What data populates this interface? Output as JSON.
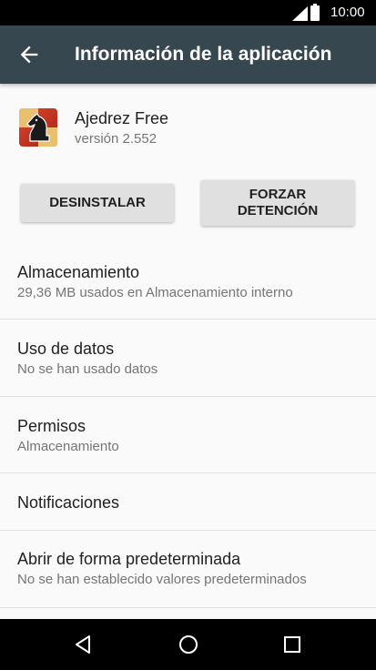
{
  "status_bar": {
    "time": "10:00",
    "signal_icon": "signal-icon",
    "battery_icon": "battery-icon"
  },
  "app_bar": {
    "title": "Información de la aplicación",
    "back_icon": "arrow-back-icon"
  },
  "app": {
    "name": "Ajedrez Free",
    "version": "versión 2.552",
    "icon": "chess-knight-icon"
  },
  "buttons": {
    "uninstall": "DESINSTALAR",
    "force_stop": "FORZAR\nDETENCIÓN"
  },
  "sections": [
    {
      "title": "Almacenamiento",
      "subtitle": "29,36 MB usados en Almacenamiento interno"
    },
    {
      "title": "Uso de datos",
      "subtitle": "No se han usado datos"
    },
    {
      "title": "Permisos",
      "subtitle": "Almacenamiento"
    },
    {
      "title": "Notificaciones",
      "subtitle": ""
    },
    {
      "title": "Abrir de forma predeterminada",
      "subtitle": "No se han establecido valores predeterminados"
    }
  ],
  "nav_bar": {
    "back": "nav-back-icon",
    "home": "nav-home-icon",
    "recents": "nav-recents-icon"
  },
  "colors": {
    "app_bar": "#37474f",
    "status_bar": "#000000",
    "background": "#fafafa",
    "button": "#e0e0e0"
  }
}
